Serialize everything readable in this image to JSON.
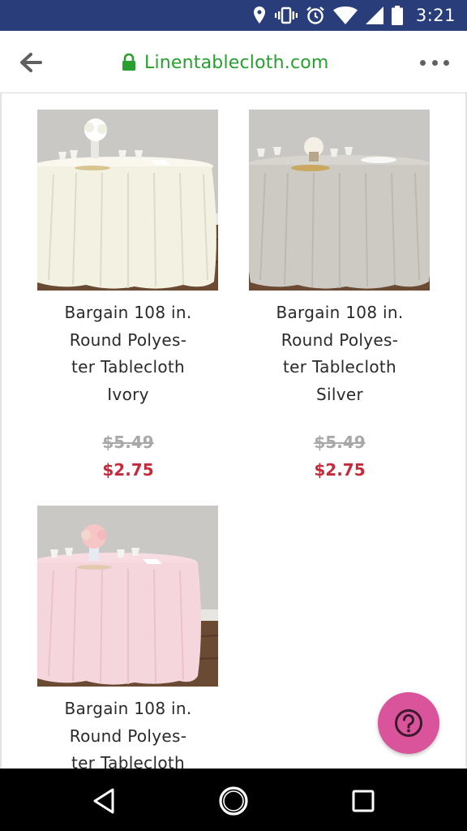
{
  "status_bar": {
    "time": "3:21",
    "icons": [
      "location-icon",
      "vibrate-icon",
      "alarm-icon",
      "wifi-icon",
      "signal-icon",
      "battery-icon"
    ]
  },
  "browser": {
    "url": "Linentablecloth.com",
    "url_color": "#27a02f",
    "icons": [
      "back-arrow-icon",
      "lock-icon",
      "more-options-icon"
    ]
  },
  "products": [
    {
      "name_lines": [
        "Bargain 108 in.",
        "Round Polyes-",
        "ter Tablecloth",
        "Ivory"
      ],
      "old_price": "$5.49",
      "new_price": "$2.75",
      "cloth_color": "#f3f1e2"
    },
    {
      "name_lines": [
        "Bargain 108 in.",
        "Round Polyes-",
        "ter Tablecloth",
        "Silver"
      ],
      "old_price": "$5.49",
      "new_price": "$2.75",
      "cloth_color": "#cdcac4"
    },
    {
      "name_lines": [
        "Bargain 108 in.",
        "Round Polyes-",
        "ter Tablecloth"
      ],
      "cloth_color": "#f5d6dd"
    }
  ],
  "help_button": {
    "icon": "question-icon",
    "color": "#d9549a"
  },
  "nav": {
    "icons": [
      "back-triangle-icon",
      "home-circle-icon",
      "recents-square-icon"
    ]
  }
}
